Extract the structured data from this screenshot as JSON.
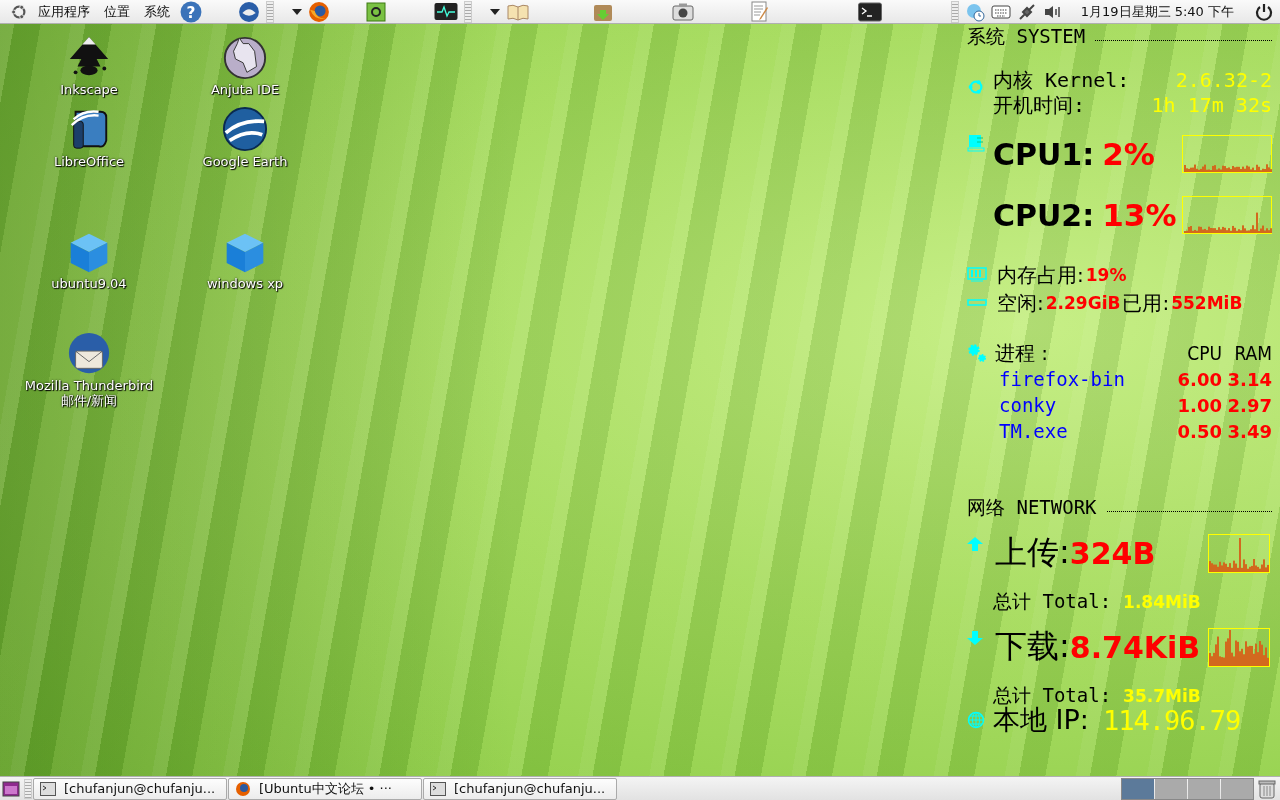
{
  "top_panel": {
    "menus": [
      {
        "label": "应用程序"
      },
      {
        "label": "位置"
      },
      {
        "label": "系统"
      }
    ],
    "help_glyph": "?",
    "clock": "1月19日星期三 5:40 下午"
  },
  "desktop_icons": [
    {
      "kind": "inkscape",
      "lines": [
        "Inkscape"
      ]
    },
    {
      "kind": "anjuta",
      "lines": [
        "Anjuta IDE"
      ]
    },
    {
      "kind": "libreoffice",
      "lines": [
        "LibreOffice"
      ]
    },
    {
      "kind": "earth",
      "lines": [
        "Google Earth"
      ]
    },
    {
      "kind": "vbox",
      "lines": [
        "ubuntu9.04"
      ]
    },
    {
      "kind": "vbox",
      "lines": [
        "windows xp"
      ]
    },
    {
      "kind": "thunderbird",
      "lines": [
        "Mozilla Thunderbird",
        "邮件/新闻"
      ]
    }
  ],
  "conky": {
    "system_heading": "系统 SYSTEM",
    "kernel_label": "内核 Kernel:",
    "kernel": "2.6.32-2",
    "uptime_label": "开机时间:",
    "uptime": "1h 17m 32s",
    "cpus": [
      {
        "label": "CPU1:",
        "value": "2%"
      },
      {
        "label": "CPU2:",
        "value": "13%"
      }
    ],
    "memory_label": "内存占用:",
    "memory": "19%",
    "free_label": "空闲:",
    "free": "2.29GiB",
    "used_label": "已用:",
    "used": "552MiB",
    "process_label": "进程 :",
    "process_columns": [
      "CPU",
      "RAM"
    ],
    "processes": [
      {
        "name": "firefox-bin",
        "cpu": "6.00",
        "ram": "3.14"
      },
      {
        "name": "conky",
        "cpu": "1.00",
        "ram": "2.97"
      },
      {
        "name": "TM.exe",
        "cpu": "0.50",
        "ram": "3.49"
      }
    ],
    "network_heading": "网络 NETWORK",
    "transfers": [
      {
        "kind": "up",
        "label": "上传:",
        "rate": "324B",
        "total_label": "总计 Total:",
        "total": "1.84MiB"
      },
      {
        "kind": "down",
        "label": "下载:",
        "rate": "8.74KiB",
        "total_label": "总计 Total:",
        "total": "35.7MiB"
      }
    ],
    "ip_label": "本地 IP:",
    "ip": "114.96.79"
  },
  "taskbar": {
    "tasks": [
      {
        "kind": "terminal",
        "label": "[chufanjun@chufanju..."
      },
      {
        "kind": "browser",
        "label": "[Ubuntu中文论坛 • ···"
      },
      {
        "kind": "terminal",
        "label": "[chufanjun@chufanju..."
      }
    ],
    "workspaces": [
      {
        "selected": true
      },
      {
        "selected": false
      },
      {
        "selected": false
      },
      {
        "selected": false
      }
    ]
  }
}
